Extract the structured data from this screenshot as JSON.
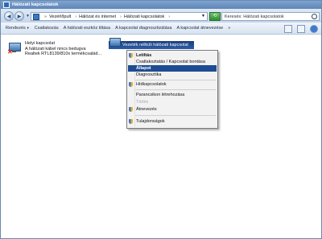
{
  "window": {
    "title": "Hálózati kapcsolatok"
  },
  "address": {
    "crumbs": [
      "Vezérlőpult",
      "Hálózat és internet",
      "Hálózati kapcsolatok"
    ],
    "search_placeholder": "Keresés: Hálózati kapcsolatok"
  },
  "toolbar": {
    "items": [
      "Rendezés",
      "Csatlakozás",
      "A hálózati eszköz tiltása",
      "A kapcsolat diagnosztizálása",
      "A kapcsolat átnevezése"
    ],
    "more": "»"
  },
  "connections": [
    {
      "name": "Helyi kapcsolat",
      "status": "A hálózati kábel nincs bedugva",
      "device": "Realtek RTL8139/810x termékcsalád..."
    },
    {
      "name": "Vezeték nélküli hálózati kapcsolat"
    }
  ],
  "context_menu": {
    "items": [
      {
        "label": "Letiltás",
        "shield": true
      },
      {
        "label": "Csatlakoztatás / Kapcsolat bontása"
      },
      {
        "label": "Állapot",
        "selected": true
      },
      {
        "label": "Diagnosztika"
      },
      {
        "label": "Hídkapcsolatok",
        "shield": true
      },
      {
        "label": "Parancsikon létrehozása"
      },
      {
        "label": "Törlés",
        "disabled": true
      },
      {
        "label": "Átnevezés",
        "shield": true
      },
      {
        "label": "Tulajdonságok",
        "shield": true
      }
    ]
  }
}
